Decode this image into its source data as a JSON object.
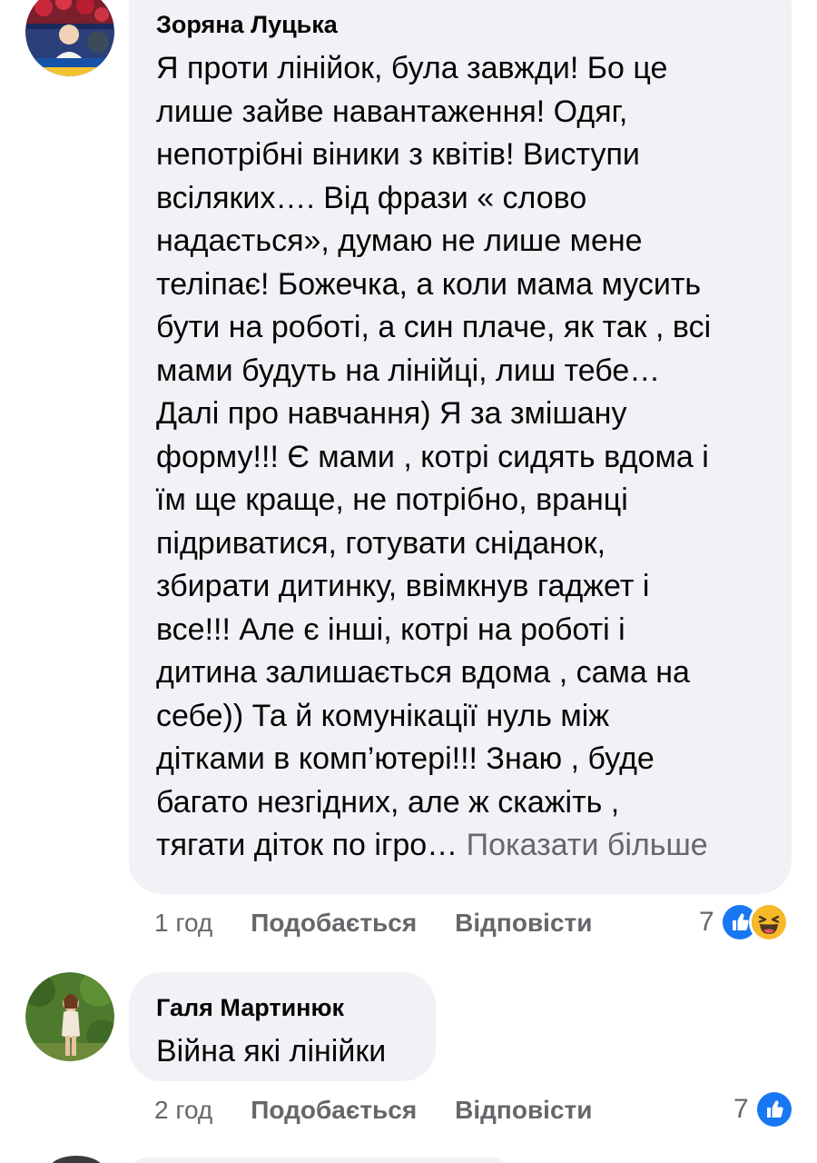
{
  "comments": [
    {
      "author": "Зоряна Луцька",
      "avatar_icon": "user-avatar-icon",
      "avatar_badge": "#StandWithUkraine",
      "text_lines": [
        "Я проти лінійок, була завжди! Бо це",
        "лише зайве навантаження! Одяг,",
        "непотрібні віники з квітів! Виступи",
        "всіляких…. Від фрази « слово",
        "надається», думаю не лише мене",
        "теліпає! Божечка, а коли мама мусить",
        "бути на роботі, а син плаче, як так , всі",
        "мами будуть на лінійці, лиш тебе…",
        "Далі про навчання) Я за змішану",
        "форму!!! Є мами , котрі сидять вдома і",
        "їм ще краще, не потрібно, вранці",
        "підриватися, готувати сніданок,",
        "збирати дитинку, ввімкнув гаджет і",
        "все!!! Але є інші, котрі на роботі і",
        "дитина залишається вдома , сама на",
        "себе)) Та й комунікації нуль між",
        "дітками в комп’ютері!!! Знаю , буде",
        "багато незгідних, але ж скажіть ,",
        "тягати діток по ігро…"
      ],
      "see_more": "Показати більше",
      "time": "1 год",
      "like_label": "Подобається",
      "reply_label": "Відповісти",
      "reaction_count": "7",
      "reactions": [
        "like-reaction-icon",
        "haha-reaction-icon"
      ]
    },
    {
      "author": "Галя Мартинюк",
      "avatar_icon": "user-avatar-icon",
      "text_lines": [
        "Війна які лінійки"
      ],
      "time": "2 год",
      "like_label": "Подобається",
      "reply_label": "Відповісти",
      "reaction_count": "7",
      "reactions": [
        "like-reaction-icon"
      ]
    }
  ],
  "colors": {
    "bubble_bg": "#f0f2f5",
    "secondary_text": "#65676b",
    "primary_text": "#050505",
    "like_blue": "#1877f2",
    "haha_yellow": "#f7b928"
  }
}
